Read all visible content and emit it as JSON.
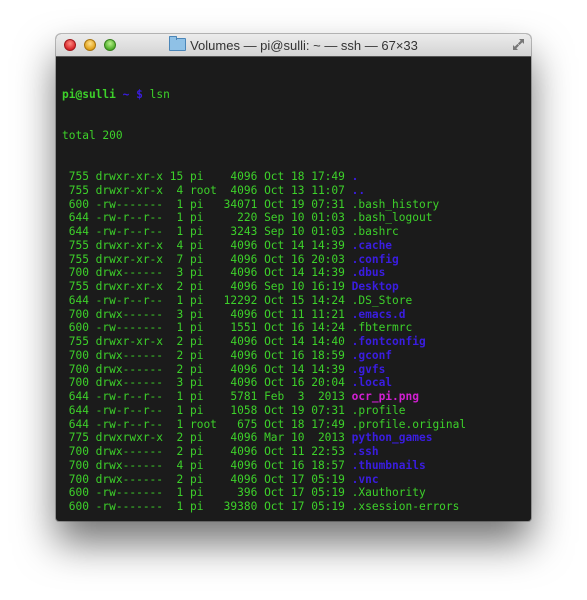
{
  "window": {
    "title": "Volumes — pi@sulli: ~ — ssh — 67×33",
    "title_icon": "folder-icon",
    "buttons": [
      "close",
      "minimize",
      "zoom"
    ],
    "fullscreen_icon": "fullscreen-arrows-icon"
  },
  "colors": {
    "background": "#1b1b1b",
    "text": "#3dd12a",
    "directory": "#3a1de0",
    "image": "#d21fd2"
  },
  "terminal": {
    "prompt": {
      "user_host": "pi@sulli",
      "path": "~",
      "symbol": "$"
    },
    "command": "lsn",
    "total": "total 200",
    "entries": [
      {
        "mode": "755",
        "perms": "drwxr-xr-x",
        "links": "15",
        "owner": "pi",
        "size": "4096",
        "month": "Oct",
        "day": "18",
        "time": "17:49",
        "name": ".",
        "type": "dir"
      },
      {
        "mode": "755",
        "perms": "drwxr-xr-x",
        "links": "4",
        "owner": "root",
        "size": "4096",
        "month": "Oct",
        "day": "13",
        "time": "11:07",
        "name": "..",
        "type": "dir"
      },
      {
        "mode": "600",
        "perms": "-rw-------",
        "links": "1",
        "owner": "pi",
        "size": "34071",
        "month": "Oct",
        "day": "19",
        "time": "07:31",
        "name": ".bash_history",
        "type": "file"
      },
      {
        "mode": "644",
        "perms": "-rw-r--r--",
        "links": "1",
        "owner": "pi",
        "size": "220",
        "month": "Sep",
        "day": "10",
        "time": "01:03",
        "name": ".bash_logout",
        "type": "file"
      },
      {
        "mode": "644",
        "perms": "-rw-r--r--",
        "links": "1",
        "owner": "pi",
        "size": "3243",
        "month": "Sep",
        "day": "10",
        "time": "01:03",
        "name": ".bashrc",
        "type": "file"
      },
      {
        "mode": "755",
        "perms": "drwxr-xr-x",
        "links": "4",
        "owner": "pi",
        "size": "4096",
        "month": "Oct",
        "day": "14",
        "time": "14:39",
        "name": ".cache",
        "type": "dir"
      },
      {
        "mode": "755",
        "perms": "drwxr-xr-x",
        "links": "7",
        "owner": "pi",
        "size": "4096",
        "month": "Oct",
        "day": "16",
        "time": "20:03",
        "name": ".config",
        "type": "dir"
      },
      {
        "mode": "700",
        "perms": "drwx------",
        "links": "3",
        "owner": "pi",
        "size": "4096",
        "month": "Oct",
        "day": "14",
        "time": "14:39",
        "name": ".dbus",
        "type": "dir"
      },
      {
        "mode": "755",
        "perms": "drwxr-xr-x",
        "links": "2",
        "owner": "pi",
        "size": "4096",
        "month": "Sep",
        "day": "10",
        "time": "16:19",
        "name": "Desktop",
        "type": "dir"
      },
      {
        "mode": "644",
        "perms": "-rw-r--r--",
        "links": "1",
        "owner": "pi",
        "size": "12292",
        "month": "Oct",
        "day": "15",
        "time": "14:24",
        "name": ".DS_Store",
        "type": "file"
      },
      {
        "mode": "700",
        "perms": "drwx------",
        "links": "3",
        "owner": "pi",
        "size": "4096",
        "month": "Oct",
        "day": "11",
        "time": "11:21",
        "name": ".emacs.d",
        "type": "dir"
      },
      {
        "mode": "600",
        "perms": "-rw-------",
        "links": "1",
        "owner": "pi",
        "size": "1551",
        "month": "Oct",
        "day": "16",
        "time": "14:24",
        "name": ".fbtermrc",
        "type": "file"
      },
      {
        "mode": "755",
        "perms": "drwxr-xr-x",
        "links": "2",
        "owner": "pi",
        "size": "4096",
        "month": "Oct",
        "day": "14",
        "time": "14:40",
        "name": ".fontconfig",
        "type": "dir"
      },
      {
        "mode": "700",
        "perms": "drwx------",
        "links": "2",
        "owner": "pi",
        "size": "4096",
        "month": "Oct",
        "day": "16",
        "time": "18:59",
        "name": ".gconf",
        "type": "dir"
      },
      {
        "mode": "700",
        "perms": "drwx------",
        "links": "2",
        "owner": "pi",
        "size": "4096",
        "month": "Oct",
        "day": "14",
        "time": "14:39",
        "name": ".gvfs",
        "type": "dir"
      },
      {
        "mode": "700",
        "perms": "drwx------",
        "links": "3",
        "owner": "pi",
        "size": "4096",
        "month": "Oct",
        "day": "16",
        "time": "20:04",
        "name": ".local",
        "type": "dir"
      },
      {
        "mode": "644",
        "perms": "-rw-r--r--",
        "links": "1",
        "owner": "pi",
        "size": "5781",
        "month": "Feb",
        "day": "3",
        "time": "2013",
        "name": "ocr_pi.png",
        "type": "img"
      },
      {
        "mode": "644",
        "perms": "-rw-r--r--",
        "links": "1",
        "owner": "pi",
        "size": "1058",
        "month": "Oct",
        "day": "19",
        "time": "07:31",
        "name": ".profile",
        "type": "file"
      },
      {
        "mode": "644",
        "perms": "-rw-r--r--",
        "links": "1",
        "owner": "root",
        "size": "675",
        "month": "Oct",
        "day": "18",
        "time": "17:49",
        "name": ".profile.original",
        "type": "file"
      },
      {
        "mode": "775",
        "perms": "drwxrwxr-x",
        "links": "2",
        "owner": "pi",
        "size": "4096",
        "month": "Mar",
        "day": "10",
        "time": "2013",
        "name": "python_games",
        "type": "dir"
      },
      {
        "mode": "700",
        "perms": "drwx------",
        "links": "2",
        "owner": "pi",
        "size": "4096",
        "month": "Oct",
        "day": "11",
        "time": "22:53",
        "name": ".ssh",
        "type": "dir"
      },
      {
        "mode": "700",
        "perms": "drwx------",
        "links": "4",
        "owner": "pi",
        "size": "4096",
        "month": "Oct",
        "day": "16",
        "time": "18:57",
        "name": ".thumbnails",
        "type": "dir"
      },
      {
        "mode": "700",
        "perms": "drwx------",
        "links": "2",
        "owner": "pi",
        "size": "4096",
        "month": "Oct",
        "day": "17",
        "time": "05:19",
        "name": ".vnc",
        "type": "dir"
      },
      {
        "mode": "600",
        "perms": "-rw-------",
        "links": "1",
        "owner": "pi",
        "size": "396",
        "month": "Oct",
        "day": "17",
        "time": "05:19",
        "name": ".Xauthority",
        "type": "file"
      },
      {
        "mode": "600",
        "perms": "-rw-------",
        "links": "1",
        "owner": "pi",
        "size": "39380",
        "month": "Oct",
        "day": "17",
        "time": "05:19",
        "name": ".xsession-errors",
        "type": "file"
      }
    ]
  }
}
